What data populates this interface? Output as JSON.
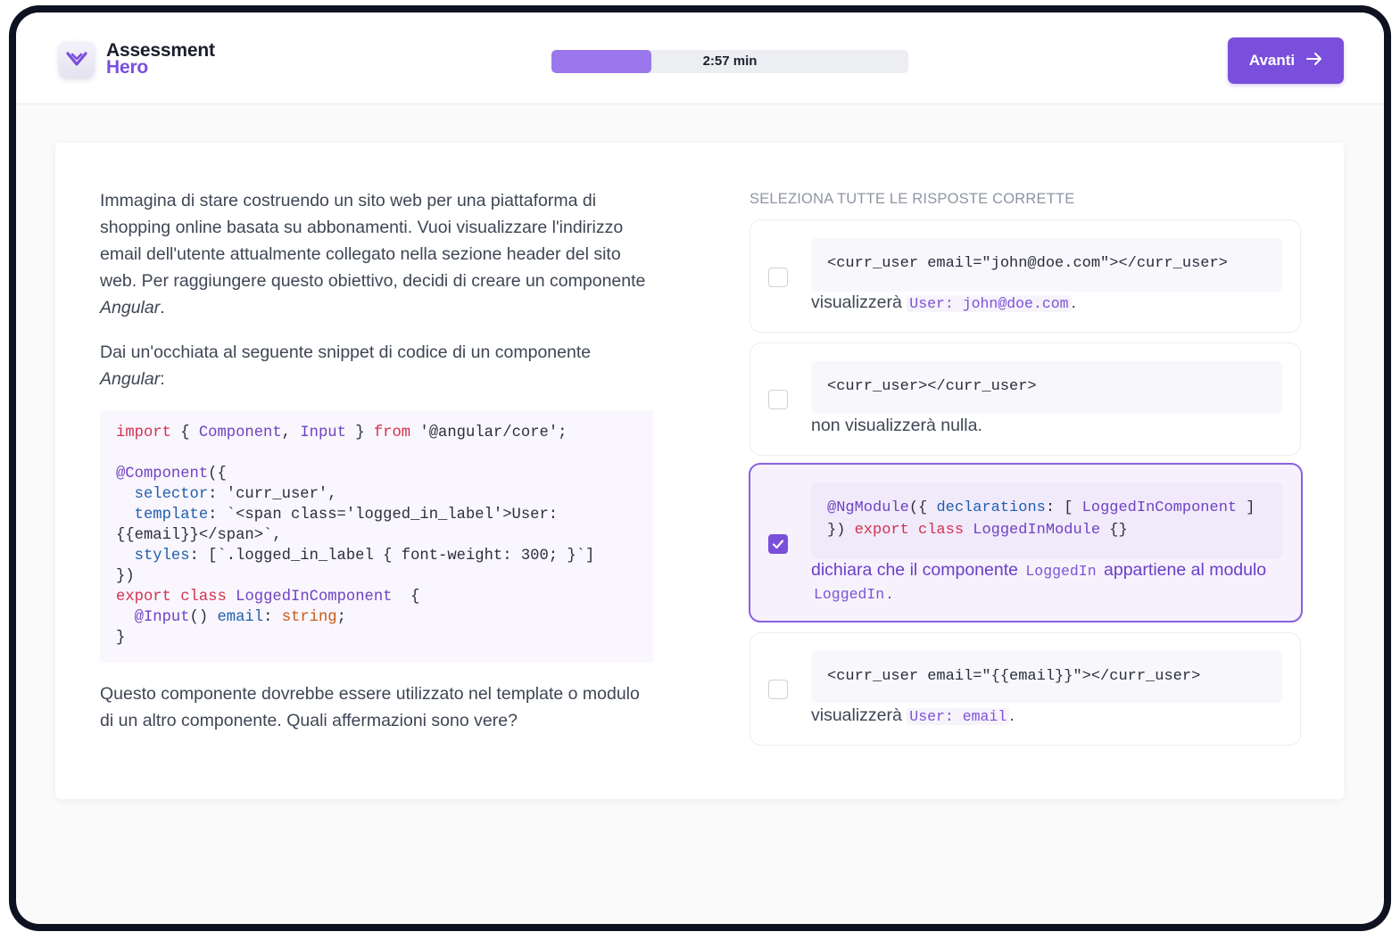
{
  "app": {
    "logo_line1": "Assessment",
    "logo_line2": "Hero",
    "brand_color": "#7a4fdc",
    "logo_icon": "heart-check-icon"
  },
  "progress": {
    "label": "2:57 min",
    "fraction": 0.28
  },
  "next_button": {
    "label": "Avanti",
    "icon": "arrow-right-icon"
  },
  "question": {
    "paragraph1_text": "Immagina di stare costruendo un sito web per una piattaforma di shopping online basata su abbonamenti. Vuoi visualizzare l'indirizzo email dell'utente attualmente collegato nella sezione header del sito web. Per raggiungere questo obiettivo, decidi di creare un componente ",
    "paragraph1_em": "Angular",
    "paragraph1_end": ".",
    "paragraph2_text": "Dai un'occhiata al seguente snippet di codice di un componente ",
    "paragraph2_em": "Angular",
    "paragraph2_end": ":",
    "code": {
      "import_kw": "import",
      "import_open": " { ",
      "import_a": "Component",
      "import_sep": ", ",
      "import_b": "Input",
      "import_close": " } ",
      "from_kw": "from",
      "import_path": " '@angular/core';",
      "decorator": "@Component",
      "decorator_open": "({",
      "selector_key": "selector",
      "selector_val": ": 'curr_user',",
      "template_key": "template",
      "template_val": ": `<span class='logged_in_label'>User:",
      "template_cont": "{{email}}</span>`,",
      "styles_key": "styles",
      "styles_val": ": [`.logged_in_label { font-weight: 300; }`]",
      "decorator_close": "})",
      "export_kw": "export",
      "class_kw": "class",
      "class_name": "LoggedInComponent",
      "class_open": "  {",
      "input_decorator": "@Input",
      "input_paren": "() ",
      "prop_name": "email",
      "prop_colon": ": ",
      "prop_type": "string",
      "prop_semi": ";",
      "class_close": "}"
    },
    "paragraph3": "Questo componente dovrebbe essere utilizzato nel template o modulo di un altro componente. Quali affermazioni sono vere?"
  },
  "answers": {
    "instruction": "SELEZIONA TUTTE LE RISPOSTE CORRETTE",
    "options": [
      {
        "checked": false,
        "snippet": "<curr_user email=\"john@doe.com\"></curr_user>",
        "desc_text": "visualizzerà ",
        "desc_code": "User: john@doe.com",
        "desc_end": "."
      },
      {
        "checked": false,
        "snippet": "<curr_user></curr_user>",
        "desc_text": "non visualizzerà nulla."
      },
      {
        "checked": true,
        "snippet_decorator": "@NgModule",
        "snippet_open": "({ ",
        "snippet_key": "declarations",
        "snippet_colon": ": [ ",
        "snippet_component": "LoggedInComponent",
        "snippet_bracket": " ]",
        "snippet_close": "}) ",
        "snippet_export": "export",
        "snippet_class": "class",
        "snippet_module": "LoggedInModule",
        "snippet_braces": " {}",
        "desc_part1": "dichiara che il componente ",
        "desc_code1": "LoggedIn",
        "desc_part2": " appartiene al modulo ",
        "desc_code2": "LoggedIn",
        "desc_end": "."
      },
      {
        "checked": false,
        "snippet": "<curr_user email=\"{{email}}\"></curr_user>",
        "desc_text": "visualizzerà ",
        "desc_code": "User: email",
        "desc_end": "."
      }
    ]
  }
}
